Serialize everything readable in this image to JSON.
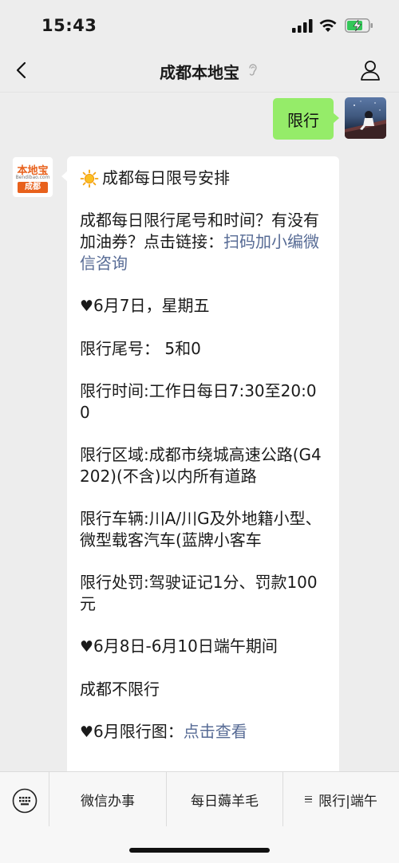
{
  "status_bar": {
    "time": "15:43"
  },
  "nav": {
    "title": "成都本地宝"
  },
  "chat": {
    "sent_message": "限行",
    "official_logo": {
      "top": "本地宝",
      "sub": "Bendibao.com",
      "city": "成都"
    },
    "message": {
      "title": "成都每日限号安排",
      "intro": "成都每日限行尾号和时间？有没有加油券？点击链接：",
      "intro_link": "扫码加小编微信咨询",
      "date_line": "6月7日，星期五",
      "tail_numbers": "限行尾号： 5和0",
      "time_line": "限行时间:工作日每日7:30至20:00",
      "area_line": "限行区域:成都市绕城高速公路(G4202)(不含)以内所有道路",
      "vehicle_line": "限行车辆:川A/川G及外地籍小型、微型载客汽车(蓝牌小客车",
      "penalty_line": "限行处罚:驾驶证记1分、罚款100元",
      "holiday_line": "6月8日-6月10日端午期间",
      "no_limit": "成都不限行",
      "map_prefix": "6月限行图：",
      "map_link": "点击查看",
      "heart": "♥"
    }
  },
  "bottom_menu": {
    "items": [
      "微信办事",
      "每日薅羊毛",
      "限行|端午"
    ]
  }
}
